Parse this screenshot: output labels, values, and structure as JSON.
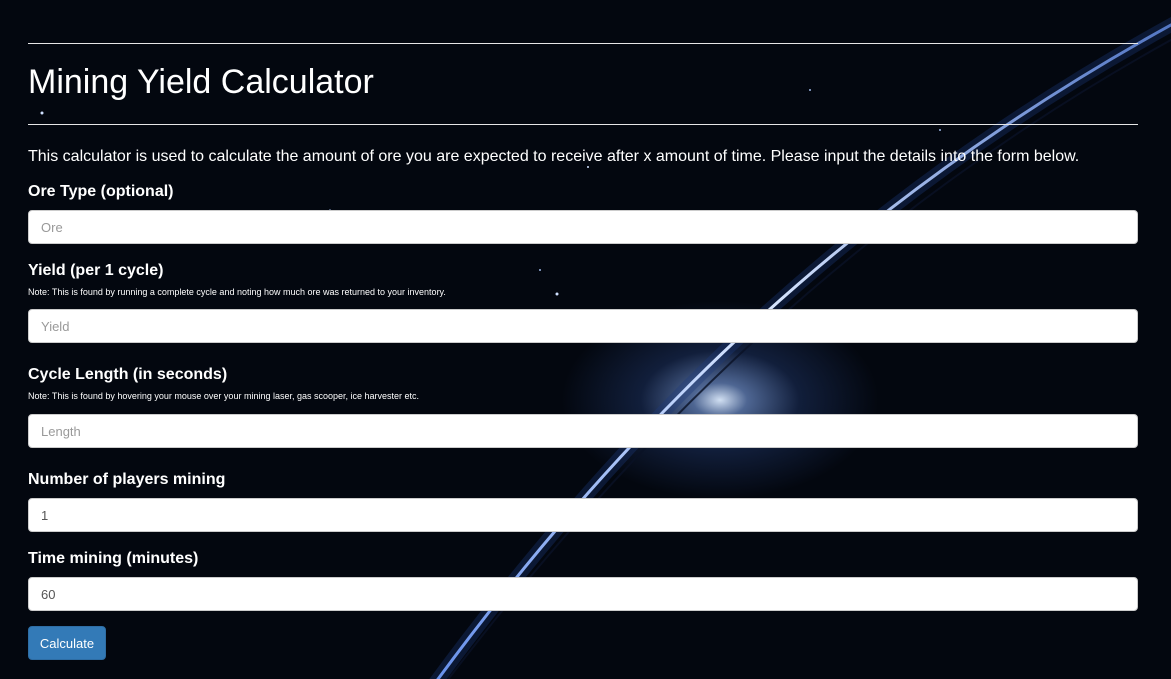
{
  "page": {
    "title": "Mining Yield Calculator",
    "intro": "This calculator is used to calculate the amount of ore you are expected to receive after x amount of time. Please input the details into the form below."
  },
  "form": {
    "ore_type": {
      "label": "Ore Type (optional)",
      "placeholder": "Ore",
      "value": ""
    },
    "yield": {
      "label": "Yield (per 1 cycle)",
      "note": "Note: This is found by running a complete cycle and noting how much ore was returned to your inventory.",
      "placeholder": "Yield",
      "value": ""
    },
    "cycle_length": {
      "label": "Cycle Length (in seconds)",
      "note": "Note: This is found by hovering your mouse over your mining laser, gas scooper, ice harvester etc.",
      "placeholder": "Length",
      "value": ""
    },
    "players": {
      "label": "Number of players mining",
      "value": "1"
    },
    "time": {
      "label": "Time mining (minutes)",
      "value": "60"
    },
    "submit_label": "Calculate"
  },
  "colors": {
    "background": "#03070f",
    "button": "#337ab7",
    "planet_rim": "#8fb4ff"
  }
}
